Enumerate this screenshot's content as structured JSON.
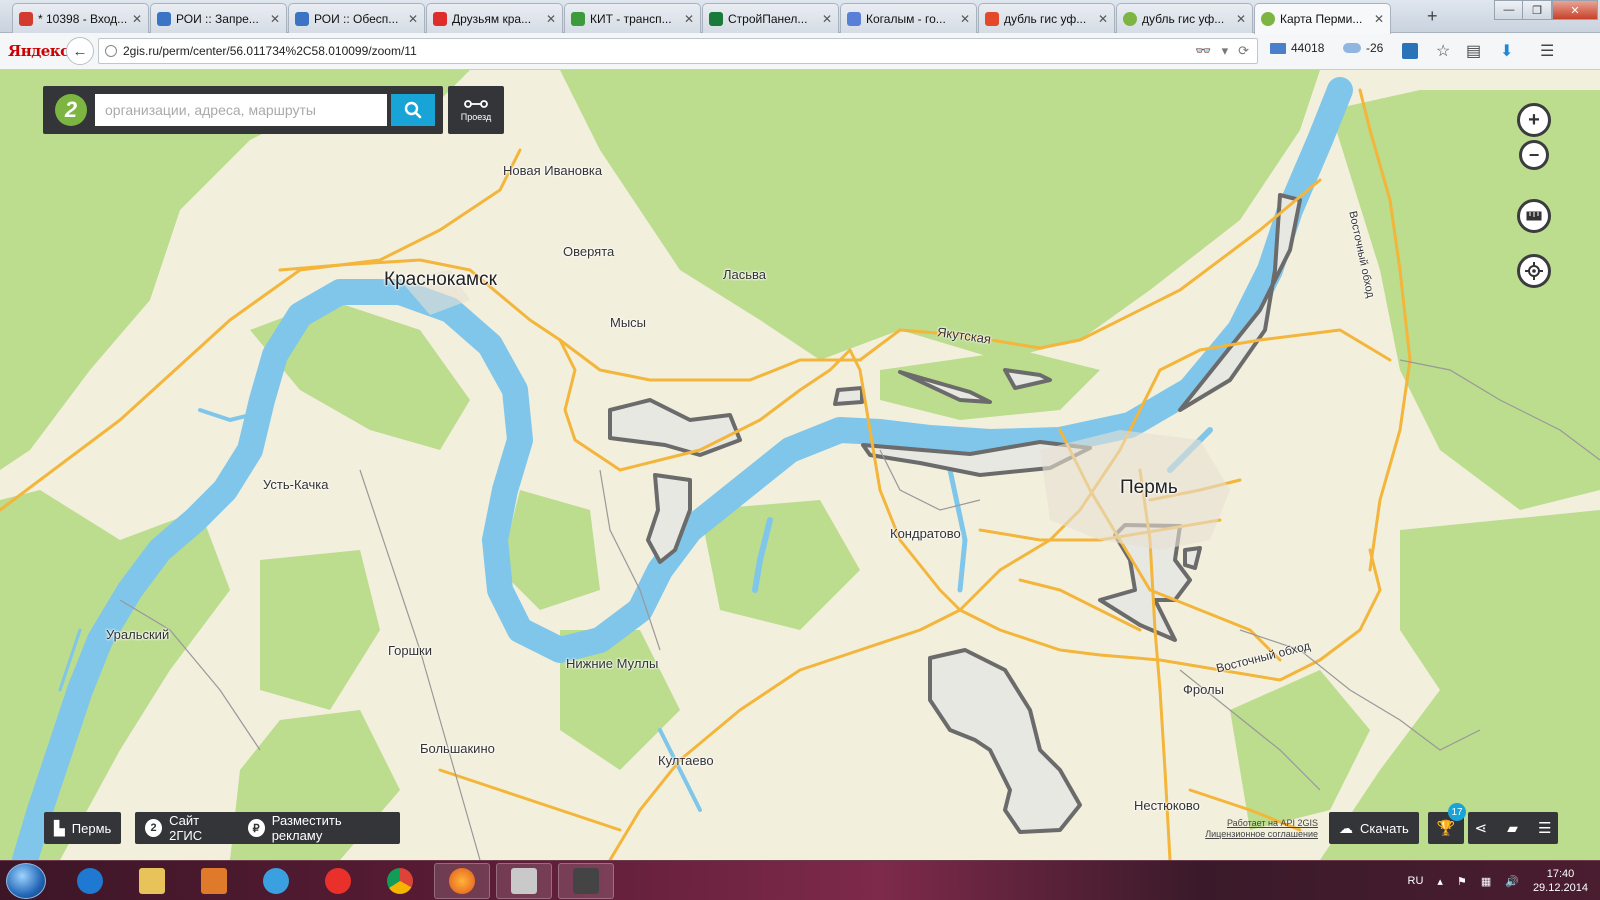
{
  "browser": {
    "tabs": [
      {
        "title": "* 10398 - Вход...",
        "icon": "mail-icon",
        "color": "#d23b2e"
      },
      {
        "title": "РОИ :: Запре...",
        "icon": "roi-icon",
        "color": "#3b74c4"
      },
      {
        "title": "РОИ :: Обесп...",
        "icon": "roi-icon",
        "color": "#3b74c4"
      },
      {
        "title": "Друзьям кра...",
        "icon": "youtube-icon",
        "color": "#e02b2b"
      },
      {
        "title": "КИТ - трансп...",
        "icon": "kit-icon",
        "color": "#3d9a3d"
      },
      {
        "title": "СтройПанел...",
        "icon": "stroypanel-icon",
        "color": "#1a7a3a"
      },
      {
        "title": "Когалым - го...",
        "icon": "kogalym-icon",
        "color": "#5a7fd6"
      },
      {
        "title": "дубль гис уф...",
        "icon": "yandex-icon",
        "color": "#e34a2c"
      },
      {
        "title": "дубль гис уф...",
        "icon": "2gis-icon",
        "color": "#7cb542"
      },
      {
        "title": "Карта Перми...",
        "icon": "2gis-icon",
        "color": "#7cb542"
      }
    ],
    "new_tab": "+",
    "window_controls": {
      "minimize": "—",
      "maximize": "❐",
      "close": "✕"
    },
    "brand": "Яндекс",
    "url": "2gis.ru/perm/center/56.011734%2C58.010099/zoom/11",
    "mail_count": "44018",
    "weather": "-26"
  },
  "search": {
    "placeholder": "организации, адреса, маршруты",
    "route_label": "Проезд"
  },
  "map_labels": {
    "krasnokamsk": "Краснокамск",
    "perm": "Пермь",
    "novaya_ivanovka": "Новая Ивановка",
    "overyata": "Оверята",
    "lasva": "Ласьва",
    "mysy": "Мысы",
    "yakutskaya": "Якутская",
    "ust_kachka": "Усть-Качка",
    "kondratovo": "Кондратово",
    "uralsky": "Уральский",
    "gorshki": "Горшки",
    "nizhnie_mully": "Нижние Муллы",
    "bolshakino": "Большакино",
    "kultaevo": "Култаево",
    "froly": "Фролы",
    "nestyukovo": "Нестюково",
    "vostochny_obkhod_1": "Восточный обход",
    "vostochny_obkhod_2": "Восточный обход"
  },
  "bottom_bar": {
    "city_button": "Пермь",
    "site_button": "Сайт 2ГИС",
    "ads_button": "Разместить рекламу",
    "download_button": "Скачать",
    "badge_count": "17",
    "api_line1": "Работает на API 2GIS",
    "api_line2": "Лицензионное соглашение"
  },
  "taskbar": {
    "lang": "RU",
    "time": "17:40",
    "date": "29.12.2014",
    "apps": [
      "ie-icon",
      "explorer-icon",
      "media-icon",
      "network-icon",
      "yandex-browser-icon",
      "chrome-icon",
      "firefox-icon",
      "keys-icon",
      "camera-icon"
    ]
  },
  "colors": {
    "river": "#7fc6ea",
    "forest": "#b9dc8c",
    "road": "#f3b53a",
    "panel": "#333538",
    "accent": "#19a4d8"
  }
}
